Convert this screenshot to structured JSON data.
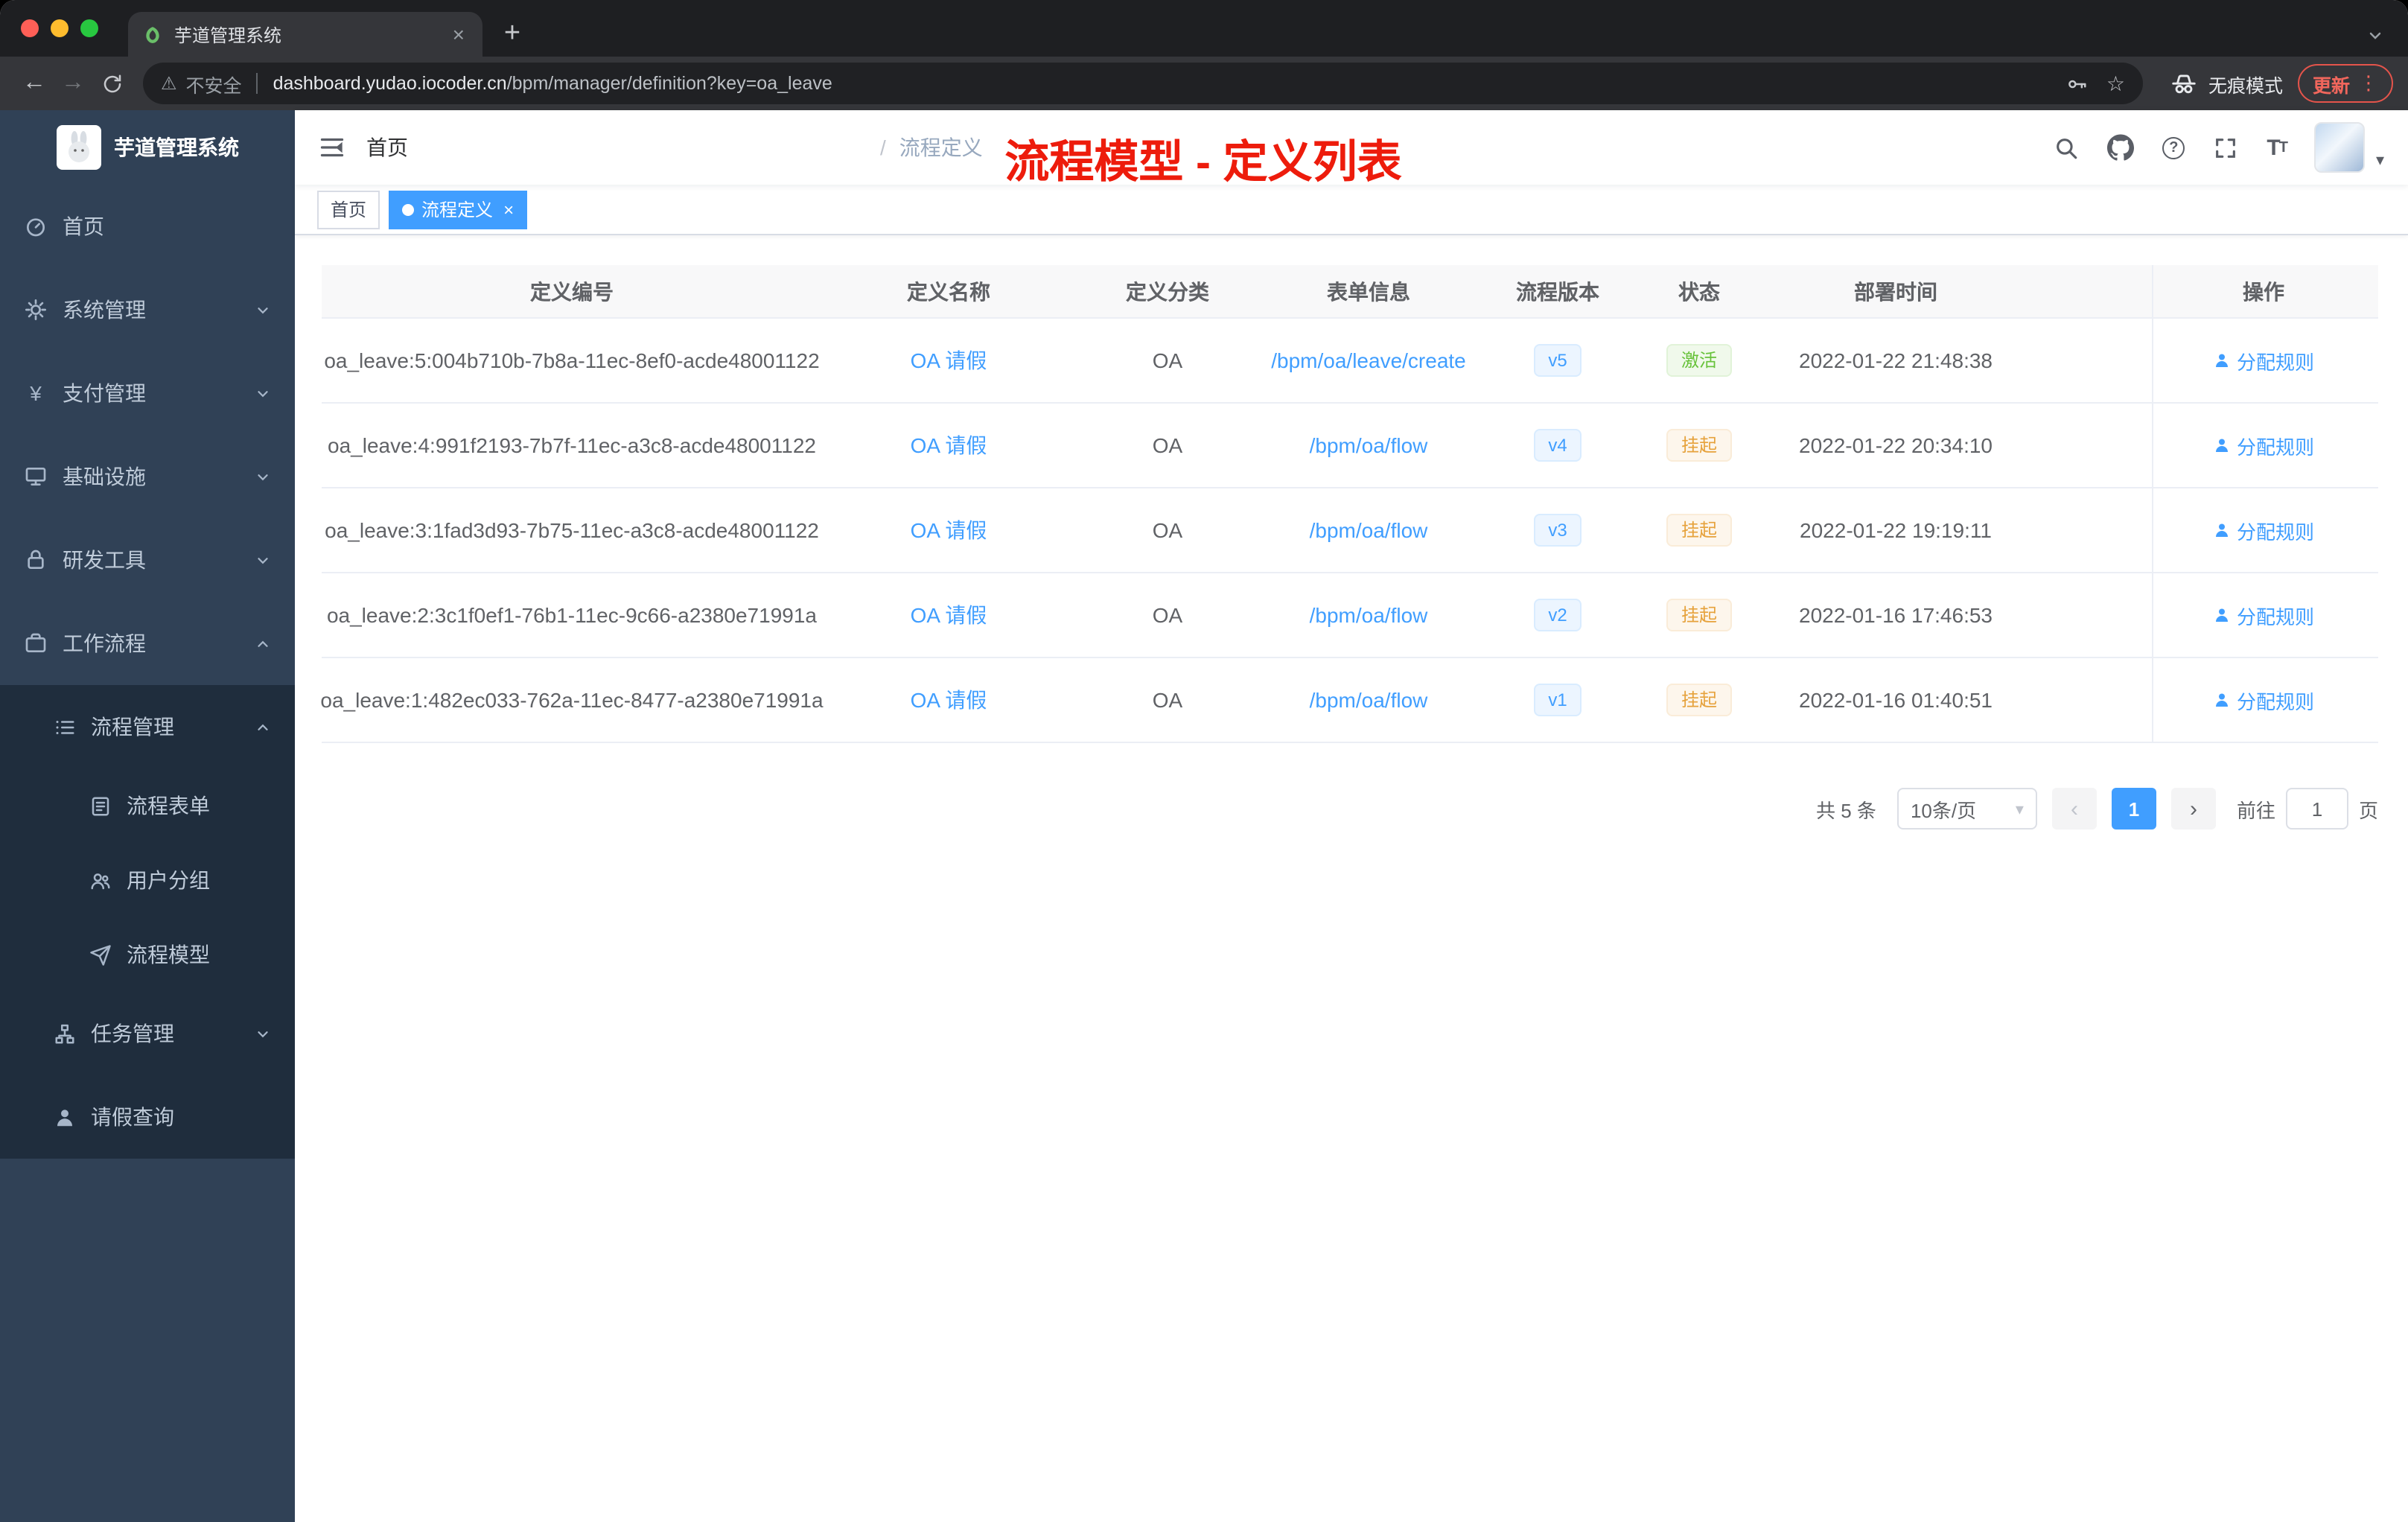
{
  "colors": {
    "accent": "#409eff",
    "success": "#67c23a",
    "warning": "#e6a23c",
    "annotation_red": "#ed1c0c",
    "sidebar_bg": "#304156",
    "submenu_bg": "#1f2d3d",
    "tag_active_bg": "#409eff"
  },
  "icons": {
    "close": "×",
    "plus": "+",
    "back": "←",
    "forward": "→",
    "kebab": "⋮",
    "star": "☆",
    "warning": "⚠",
    "caret_down": "▾",
    "prev": "‹",
    "next": "›",
    "question": "?",
    "yen": "¥",
    "separator": "/"
  },
  "browser": {
    "tab_title": "芋道管理系统",
    "security_label": "不安全",
    "url_domain": "dashboard.yudao.iocoder.cn",
    "url_path": "/bpm/manager/definition?key=oa_leave",
    "incognito_label": "无痕模式",
    "update_label": "更新"
  },
  "sidebar": {
    "logo_title": "芋道管理系统",
    "items": [
      {
        "label": "首页"
      },
      {
        "label": "系统管理"
      },
      {
        "label": "支付管理"
      },
      {
        "label": "基础设施"
      },
      {
        "label": "研发工具"
      },
      {
        "label": "工作流程"
      },
      {
        "label": "流程管理"
      },
      {
        "label": "流程表单"
      },
      {
        "label": "用户分组"
      },
      {
        "label": "流程模型"
      },
      {
        "label": "任务管理"
      },
      {
        "label": "请假查询"
      }
    ]
  },
  "navbar": {
    "breadcrumb": [
      "首页",
      "流程定义"
    ],
    "annotation": "流程模型 - 定义列表"
  },
  "tags": [
    {
      "label": "首页",
      "active": false
    },
    {
      "label": "流程定义",
      "active": true
    }
  ],
  "table": {
    "columns": [
      "定义编号",
      "定义名称",
      "定义分类",
      "表单信息",
      "流程版本",
      "状态",
      "部署时间",
      "操作"
    ],
    "action_label": "分配规则",
    "rows": [
      {
        "id": "oa_leave:5:004b710b-7b8a-11ec-8ef0-acde48001122",
        "name": "OA 请假",
        "category": "OA",
        "form": "/bpm/oa/leave/create",
        "version": "v5",
        "status": "激活",
        "time": "2022-01-22 21:48:38"
      },
      {
        "id": "oa_leave:4:991f2193-7b7f-11ec-a3c8-acde48001122",
        "name": "OA 请假",
        "category": "OA",
        "form": "/bpm/oa/flow",
        "version": "v4",
        "status": "挂起",
        "time": "2022-01-22 20:34:10"
      },
      {
        "id": "oa_leave:3:1fad3d93-7b75-11ec-a3c8-acde48001122",
        "name": "OA 请假",
        "category": "OA",
        "form": "/bpm/oa/flow",
        "version": "v3",
        "status": "挂起",
        "time": "2022-01-22 19:19:11"
      },
      {
        "id": "oa_leave:2:3c1f0ef1-76b1-11ec-9c66-a2380e71991a",
        "name": "OA 请假",
        "category": "OA",
        "form": "/bpm/oa/flow",
        "version": "v2",
        "status": "挂起",
        "time": "2022-01-16 17:46:53"
      },
      {
        "id": "oa_leave:1:482ec033-762a-11ec-8477-a2380e71991a",
        "name": "OA 请假",
        "category": "OA",
        "form": "/bpm/oa/flow",
        "version": "v1",
        "status": "挂起",
        "time": "2022-01-16 01:40:51"
      }
    ]
  },
  "pagination": {
    "total": "共 5 条",
    "page_size": "10条/页",
    "current_page": "1",
    "goto_prefix": "前往",
    "goto_value": "1",
    "goto_suffix": "页"
  }
}
